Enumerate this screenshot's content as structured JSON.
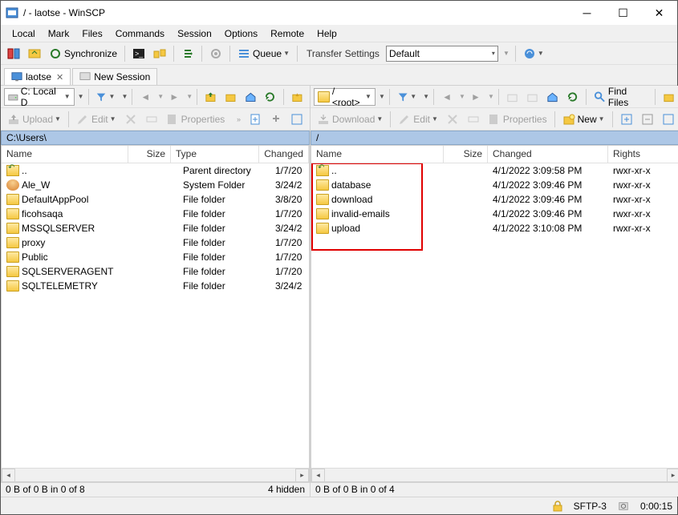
{
  "window": {
    "title": "/ - laotse - WinSCP"
  },
  "menu": {
    "items": [
      "Local",
      "Mark",
      "Files",
      "Commands",
      "Session",
      "Options",
      "Remote",
      "Help"
    ]
  },
  "toolbar1": {
    "synchronize": "Synchronize",
    "queue": "Queue",
    "transfer_label": "Transfer Settings",
    "transfer_value": "Default"
  },
  "tabs": {
    "session": "laotse",
    "new": "New Session"
  },
  "left": {
    "drive": "C: Local D",
    "upload": "Upload",
    "edit": "Edit",
    "properties": "Properties",
    "path": "C:\\Users\\",
    "cols": {
      "name": "Name",
      "size": "Size",
      "type": "Type",
      "changed": "Changed"
    },
    "rows": [
      {
        "name": "..",
        "type_text": "Parent directory",
        "changed": "1/7/20",
        "icon": "up"
      },
      {
        "name": "Ale_W",
        "type_text": "System Folder",
        "changed": "3/24/2",
        "icon": "user"
      },
      {
        "name": "DefaultAppPool",
        "type_text": "File folder",
        "changed": "3/8/20",
        "icon": "folder"
      },
      {
        "name": "ficohsaqa",
        "type_text": "File folder",
        "changed": "1/7/20",
        "icon": "folder"
      },
      {
        "name": "MSSQLSERVER",
        "type_text": "File folder",
        "changed": "3/24/2",
        "icon": "folder"
      },
      {
        "name": "proxy",
        "type_text": "File folder",
        "changed": "1/7/20",
        "icon": "folder"
      },
      {
        "name": "Public",
        "type_text": "File folder",
        "changed": "1/7/20",
        "icon": "folder"
      },
      {
        "name": "SQLSERVERAGENT",
        "type_text": "File folder",
        "changed": "1/7/20",
        "icon": "folder"
      },
      {
        "name": "SQLTELEMETRY",
        "type_text": "File folder",
        "changed": "3/24/2",
        "icon": "folder"
      }
    ],
    "status": "0 B of 0 B in 0 of 8",
    "hidden": "4 hidden"
  },
  "right": {
    "drive": "/ <root>",
    "find": "Find Files",
    "download": "Download",
    "edit": "Edit",
    "properties": "Properties",
    "new": "New",
    "path": "/",
    "cols": {
      "name": "Name",
      "size": "Size",
      "changed": "Changed",
      "rights": "Rights"
    },
    "rows": [
      {
        "name": "..",
        "changed": "4/1/2022 3:09:58 PM",
        "rights": "rwxr-xr-x",
        "icon": "up"
      },
      {
        "name": "database",
        "changed": "4/1/2022 3:09:46 PM",
        "rights": "rwxr-xr-x",
        "icon": "folder"
      },
      {
        "name": "download",
        "changed": "4/1/2022 3:09:46 PM",
        "rights": "rwxr-xr-x",
        "icon": "folder"
      },
      {
        "name": "invalid-emails",
        "changed": "4/1/2022 3:09:46 PM",
        "rights": "rwxr-xr-x",
        "icon": "folder"
      },
      {
        "name": "upload",
        "changed": "4/1/2022 3:10:08 PM",
        "rights": "rwxr-xr-x",
        "icon": "folder"
      }
    ],
    "status": "0 B of 0 B in 0 of 4"
  },
  "bottom": {
    "protocol": "SFTP-3",
    "time": "0:00:15"
  }
}
